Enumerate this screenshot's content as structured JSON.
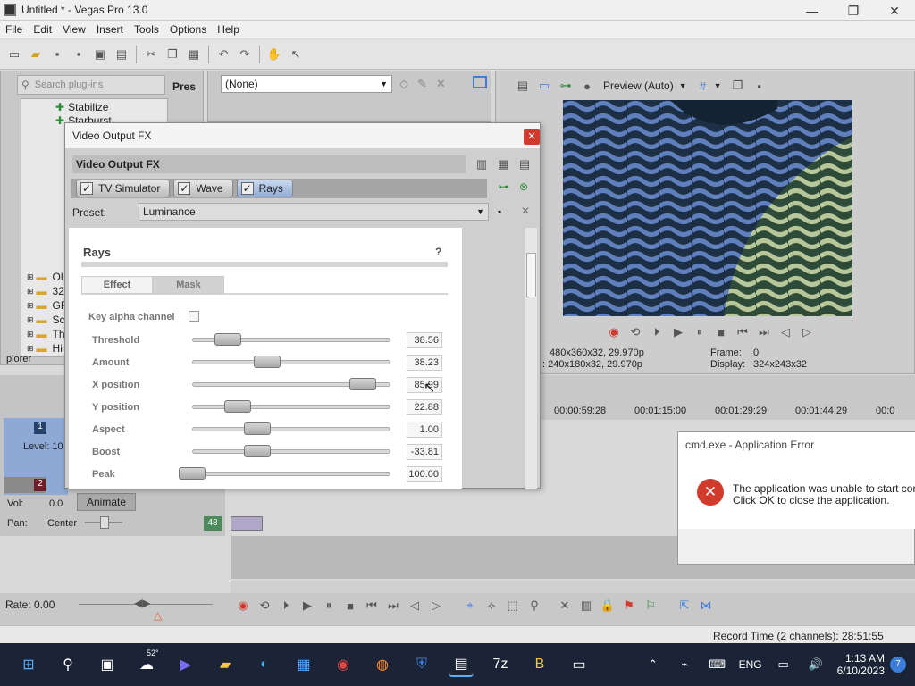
{
  "window": {
    "title": "Untitled * - Vegas Pro 13.0",
    "min": "—",
    "max": "❐",
    "close": "✕"
  },
  "menu": [
    {
      "label": "File",
      "ul": "F"
    },
    {
      "label": "Edit",
      "ul": "E"
    },
    {
      "label": "View",
      "ul": "V"
    },
    {
      "label": "Insert",
      "ul": "I"
    },
    {
      "label": "Tools",
      "ul": "T"
    },
    {
      "label": "Options",
      "ul": "O"
    },
    {
      "label": "Help",
      "ul": "H"
    }
  ],
  "plugins": {
    "search_placeholder": "Search plug-ins",
    "pres_tab": "Pres",
    "items": [
      "Stabilize",
      "Starburst"
    ],
    "folders": [
      "Ol",
      "32",
      "GF",
      "Sc",
      "Th",
      "Hi"
    ],
    "explorer_tab": "plorer"
  },
  "preset_dropdown": {
    "value": "(None)"
  },
  "preview": {
    "label": "Preview (Auto)",
    "info_left1": "480x360x32, 29.970p",
    "info_left2": ": 240x180x32, 29.970p",
    "frame_label": "Frame:",
    "frame_value": "0",
    "display_label": "Display:",
    "display_value": "324x243x32"
  },
  "timeline": {
    "ticks": [
      "00:00:59:28",
      "00:01:15:00",
      "00:01:29:29",
      "00:01:44:29",
      "00:0"
    ]
  },
  "track": {
    "t1_num": "1",
    "level_label": "Level: 10",
    "t2_num": "2",
    "vol_label": "Vol:",
    "vol_value": "0.0",
    "pan_label": "Pan:",
    "pan_value": "Center",
    "animate": "Animate",
    "event_num": "48"
  },
  "fx": {
    "title": "Video Output FX",
    "chain_title": "Video Output FX",
    "chain": [
      "TV Simulator",
      "Wave",
      "Rays"
    ],
    "preset_label": "Preset:",
    "preset_value": "Luminance",
    "plugin_name": "Rays",
    "help": "?",
    "tabs": [
      "Effect",
      "Mask"
    ],
    "key_alpha": "Key alpha channel",
    "params": [
      {
        "label": "Threshold",
        "value": "38.56",
        "level": 0.18
      },
      {
        "label": "Amount",
        "value": "38.23",
        "level": 0.38
      },
      {
        "label": "X position",
        "value": "85.99",
        "level": 0.86
      },
      {
        "label": "Y position",
        "value": "22.88",
        "level": 0.23
      },
      {
        "label": "Aspect",
        "value": "1.00",
        "level": 0.33
      },
      {
        "label": "Boost",
        "value": "-33.81",
        "level": 0.33
      },
      {
        "label": "Peak",
        "value": "100.00",
        "level": 0.0
      }
    ]
  },
  "status": {
    "rate": "Rate: 0.00",
    "record_time": "Record Time (2 channels): 28:51:55"
  },
  "error": {
    "title": "cmd.exe - Application Error",
    "line1": "The application was unable to start corr",
    "line2": "Click OK to close the application."
  },
  "taskbar": {
    "temp": "52°",
    "lang": "ENG",
    "time": "1:13 AM",
    "date": "6/10/2023",
    "notif": "7"
  },
  "colors": {
    "accent": "#3c7dd9",
    "error_red": "#d23b2b",
    "taskbar": "#1a2436"
  }
}
